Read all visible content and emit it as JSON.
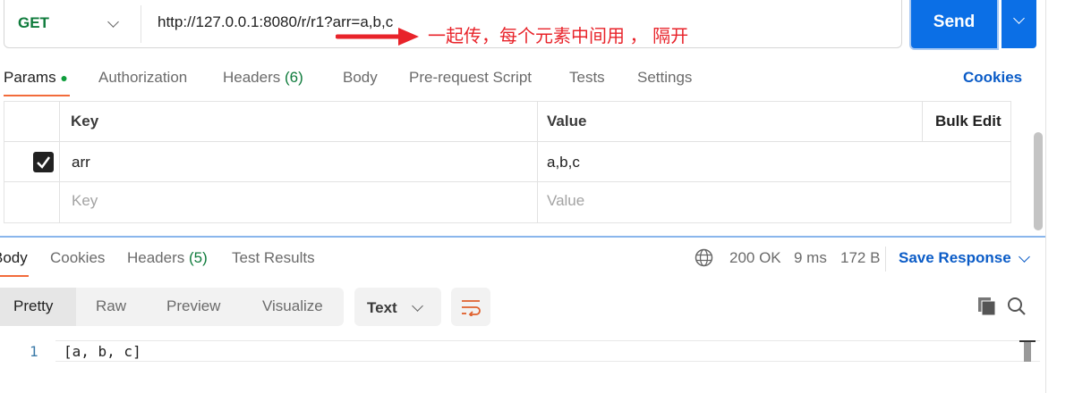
{
  "request": {
    "method": "GET",
    "url": "http://127.0.0.1:8080/r/r1?arr=a,b,c",
    "send_label": "Send"
  },
  "annotation": "一起传，每个元素中间用 ， 隔开",
  "request_tabs": [
    {
      "label": "Params"
    },
    {
      "label": "Authorization"
    },
    {
      "label": "Headers",
      "count": "(6)"
    },
    {
      "label": "Body"
    },
    {
      "label": "Pre-request Script"
    },
    {
      "label": "Tests"
    },
    {
      "label": "Settings"
    }
  ],
  "cookies_link": "Cookies",
  "params_table": {
    "headers": {
      "key": "Key",
      "value": "Value",
      "bulk": "Bulk Edit"
    },
    "rows": [
      {
        "checked": true,
        "key": "arr",
        "value": "a,b,c"
      }
    ],
    "placeholder": {
      "key": "Key",
      "value": "Value"
    }
  },
  "response_tabs": [
    {
      "label": "Body"
    },
    {
      "label": "Cookies"
    },
    {
      "label": "Headers",
      "count": "(5)"
    },
    {
      "label": "Test Results"
    }
  ],
  "status": {
    "code": "200 OK",
    "time": "9 ms",
    "size": "172 B"
  },
  "save_response": "Save Response",
  "view_modes": [
    "Pretty",
    "Raw",
    "Preview",
    "Visualize"
  ],
  "format": "Text",
  "body_lines": [
    {
      "num": "1",
      "text": "[a, b, c]"
    }
  ],
  "colors": {
    "accent": "#0b6fe6",
    "tab_underline": "#f26b3a",
    "status": "#0f7b3c",
    "link": "#0b5cc7",
    "annotation": "#e8232a"
  }
}
